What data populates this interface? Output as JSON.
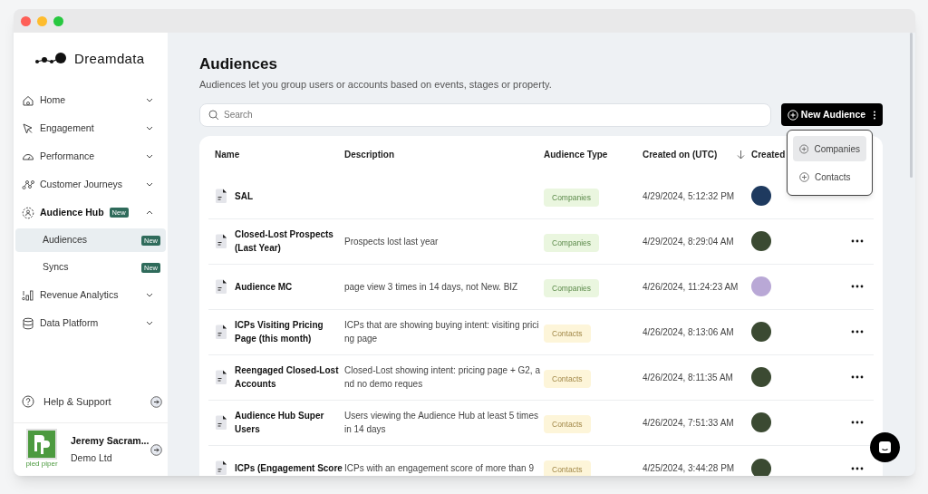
{
  "brand": "Dreamdata",
  "nav": [
    {
      "label": "Home",
      "expanded": false,
      "selected": false
    },
    {
      "label": "Engagement",
      "expanded": false,
      "selected": false
    },
    {
      "label": "Performance",
      "expanded": false,
      "selected": false
    },
    {
      "label": "Customer Journeys",
      "expanded": false,
      "selected": false
    },
    {
      "label": "Audience Hub",
      "badge": "New",
      "expanded": true,
      "selected": true,
      "children": [
        {
          "label": "Audiences",
          "badge": "New",
          "selected": true
        },
        {
          "label": "Syncs",
          "badge": "New",
          "selected": false
        }
      ]
    },
    {
      "label": "Revenue Analytics",
      "expanded": false,
      "selected": false
    },
    {
      "label": "Data Platform",
      "expanded": false,
      "selected": false
    }
  ],
  "help": "Help & Support",
  "user": {
    "logo_text": "pied piper",
    "name": "Jeremy Sacram...",
    "company": "Demo Ltd"
  },
  "page": {
    "title": "Audiences",
    "subtitle": "Audiences let you group users or accounts based on events, stages or property."
  },
  "search": {
    "placeholder": "Search"
  },
  "new_button": "New Audience",
  "dropdown": [
    {
      "label": "Companies",
      "selected": true
    },
    {
      "label": "Contacts",
      "selected": false
    }
  ],
  "table": {
    "columns": [
      "Name",
      "Description",
      "Audience Type",
      "Created on (UTC)",
      "Created"
    ],
    "rows": [
      {
        "name": "SAL",
        "kind": "companies",
        "type_label": "Companies",
        "created": "4/29/2024, 5:12:32 PM",
        "color": "#1e3a5f",
        "has_menu": false
      },
      {
        "name": "Closed-Lost Prospects (Last Year)",
        "description": "Prospects lost last year",
        "kind": "companies",
        "type_label": "Companies",
        "created": "4/29/2024, 8:29:04 AM",
        "color": "#3b4a32",
        "has_menu": true
      },
      {
        "name": "Audience MC",
        "description": "page view 3 times in 14 days, not New. BIZ",
        "kind": "companies",
        "type_label": "Companies",
        "created": "4/26/2024, 11:24:23 AM",
        "color": "#b9a8d6",
        "has_menu": true
      },
      {
        "name": "ICPs Visiting Pricing Page (this month)",
        "description": "ICPs that are showing buying intent: visiting pricing page",
        "kind": "contacts",
        "type_label": "Contacts",
        "created": "4/26/2024, 8:13:06 AM",
        "color": "#3b4a32",
        "has_menu": true
      },
      {
        "name": "Reengaged Closed-Lost Accounts",
        "description": "Closed-Lost showing intent: pricing page + G2, and no demo reques",
        "kind": "contacts",
        "type_label": "Contacts",
        "created": "4/26/2024, 8:11:35 AM",
        "color": "#3b4a32",
        "has_menu": true
      },
      {
        "name": "Audience Hub Super Users",
        "description": "Users viewing the Audience Hub at least 5 times in 14 days",
        "kind": "contacts",
        "type_label": "Contacts",
        "created": "4/26/2024, 7:51:33 AM",
        "color": "#3b4a32",
        "has_menu": true
      },
      {
        "name": "ICPs (Engagement Score",
        "description": "ICPs with an engagement score of more than 9",
        "kind": "contacts",
        "type_label": "Contacts",
        "created": "4/25/2024, 3:44:28 PM",
        "color": "#3b4a32",
        "has_menu": true
      }
    ]
  }
}
